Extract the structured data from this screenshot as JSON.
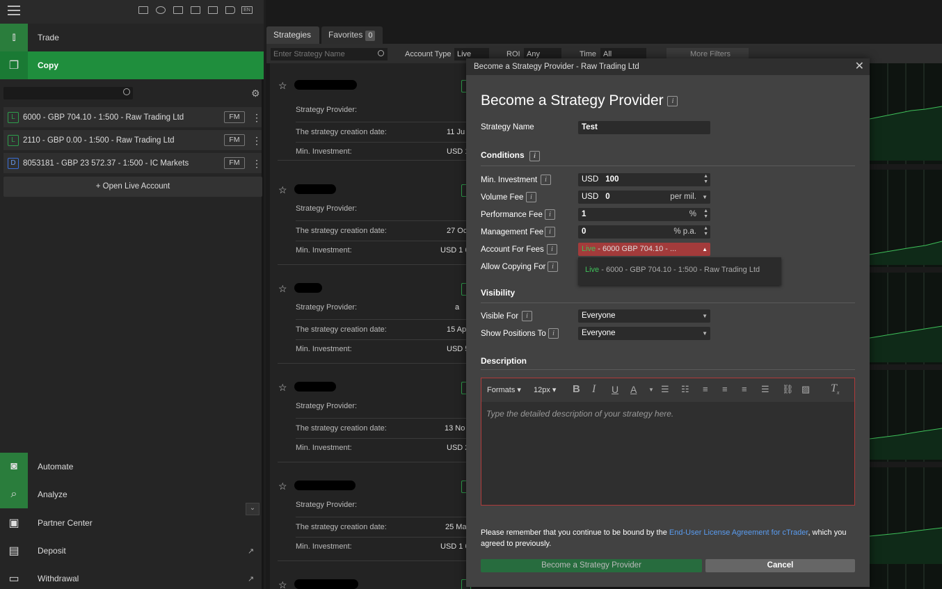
{
  "sidebar": {
    "nav": {
      "trade": "Trade",
      "copy": "Copy",
      "automate": "Automate",
      "analyze": "Analyze",
      "partner": "Partner Center",
      "deposit": "Deposit",
      "withdrawal": "Withdrawal"
    },
    "lang": "EN",
    "accounts": [
      {
        "type": "L",
        "label": "6000  - GBP 704.10 - 1:500 - Raw Trading Ltd",
        "fm": "FM"
      },
      {
        "type": "L",
        "label": "2110  - GBP 0.00 - 1:500 - Raw Trading Ltd",
        "fm": "FM"
      },
      {
        "type": "D",
        "label": "8053181 - GBP 23 572.37 - 1:500 - IC Markets",
        "fm": "FM"
      }
    ],
    "open_live": "+ Open Live Account"
  },
  "main": {
    "tabs": {
      "strategies": "Strategies",
      "favorites": "Favorites",
      "favorites_count": "0"
    },
    "filters": {
      "search_placeholder": "Enter Strategy Name",
      "account_type_label": "Account Type",
      "account_type_value": "Live",
      "roi_label": "ROI",
      "roi_value": "Any",
      "time_label": "Time",
      "time_value": "All",
      "more": "More Filters"
    },
    "cards": [
      {
        "provider_label": "Strategy Provider:",
        "date_label": "The strategy creation date:",
        "date": "11 Ju",
        "min_label": "Min. Investment:",
        "min": "USD 1"
      },
      {
        "provider_label": "Strategy Provider:",
        "date_label": "The strategy creation date:",
        "date": "27 Oc",
        "min_label": "Min. Investment:",
        "min": "USD 1 0"
      },
      {
        "provider_label": "Strategy Provider:",
        "date_label": "The strategy creation date:",
        "date": "15 Ap",
        "min_label": "Min. Investment:",
        "min": "USD 5"
      },
      {
        "provider_label": "Strategy Provider:",
        "date_label": "The strategy creation date:",
        "date": "13 No",
        "min_label": "Min. Investment:",
        "min": "USD 2"
      },
      {
        "provider_label": "Strategy Provider:",
        "date_label": "The strategy creation date:",
        "date": "25 Ma",
        "min_label": "Min. Investment:",
        "min": "USD 1 0"
      }
    ],
    "extra_card_letter": "a"
  },
  "modal": {
    "header": "Become a Strategy Provider - Raw Trading Ltd",
    "title": "Become a Strategy Provider",
    "strategy_name_label": "Strategy Name",
    "strategy_name_value": "Test",
    "conditions": "Conditions",
    "min_investment_label": "Min. Investment",
    "min_investment_currency": "USD",
    "min_investment_value": "100",
    "volume_fee_label": "Volume Fee",
    "volume_fee_currency": "USD",
    "volume_fee_value": "0",
    "volume_fee_unit": "per mil.",
    "performance_fee_label": "Performance Fee",
    "performance_fee_value": "1",
    "performance_fee_unit": "%",
    "management_fee_label": "Management Fee",
    "management_fee_value": "0",
    "management_fee_unit": "% p.a.",
    "account_fees_label": "Account For Fees",
    "account_fees_live": "Live",
    "account_fees_value": " - 6000      GBP 704.10 - ...",
    "allow_copying_label": "Allow Copying For",
    "dropdown_option_live": "Live",
    "dropdown_option_rest": " - 6000     - GBP 704.10 - 1:500 - Raw Trading Ltd",
    "visibility": "Visibility",
    "visible_for_label": "Visible For",
    "visible_for_value": "Everyone",
    "show_positions_label": "Show Positions To",
    "show_positions_value": "Everyone",
    "description": "Description",
    "editor": {
      "formats": "Formats",
      "size": "12px",
      "placeholder": "Type the detailed description of your strategy here."
    },
    "note_pre": "Please remember that you continue to be bound by the ",
    "note_link": "End-User License Agreement for cTrader",
    "note_post": ", which you agreed to previously.",
    "become_button": "Become a Strategy Provider",
    "cancel_button": "Cancel"
  },
  "colors": {
    "accent": "#1f8e3d",
    "error_border": "#b03a3a",
    "link": "#5a9cf0"
  }
}
